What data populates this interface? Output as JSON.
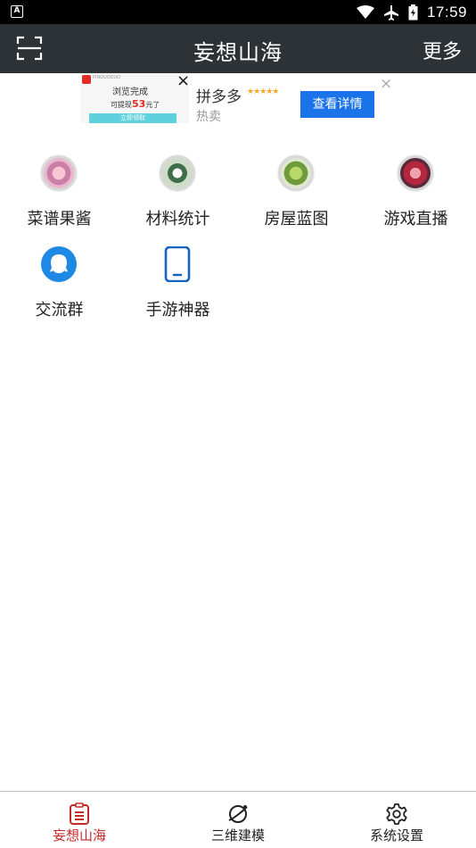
{
  "status_bar": {
    "time": "17:59",
    "app_badge": "A"
  },
  "app_bar": {
    "title": "妄想山海",
    "more_label": "更多"
  },
  "ad": {
    "thumb_logo_text": "PINDUODUO",
    "thumb_line1": "浏览完成",
    "thumb_line2_prefix": "可提现",
    "thumb_line2_amount": "53",
    "thumb_line2_suffix": "元了",
    "thumb_cta": "立即领取",
    "close_glyph": "×",
    "brand": "拼多多",
    "stars": "★★★★★",
    "subtitle": "热卖",
    "detail_button": "查看详情",
    "dismiss_glyph": "×"
  },
  "grid": {
    "items": [
      {
        "label": "菜谱果酱",
        "icon": "recipe-jam-icon"
      },
      {
        "label": "材料统计",
        "icon": "material-stats-icon"
      },
      {
        "label": "房屋蓝图",
        "icon": "house-blueprint-icon"
      },
      {
        "label": "游戏直播",
        "icon": "game-live-icon"
      },
      {
        "label": "交流群",
        "icon": "qq-group-icon"
      },
      {
        "label": "手游神器",
        "icon": "phone-tool-icon"
      }
    ]
  },
  "bottom_nav": {
    "items": [
      {
        "label": "妄想山海",
        "icon": "list-icon",
        "active": true
      },
      {
        "label": "三维建模",
        "icon": "planet-icon",
        "active": false
      },
      {
        "label": "系统设置",
        "icon": "gear-icon",
        "active": false
      }
    ]
  },
  "colors": {
    "app_bar": "#2d3236",
    "accent_red": "#c62828",
    "qq_blue": "#1e88e5",
    "ad_button_blue": "#1a73e8"
  }
}
